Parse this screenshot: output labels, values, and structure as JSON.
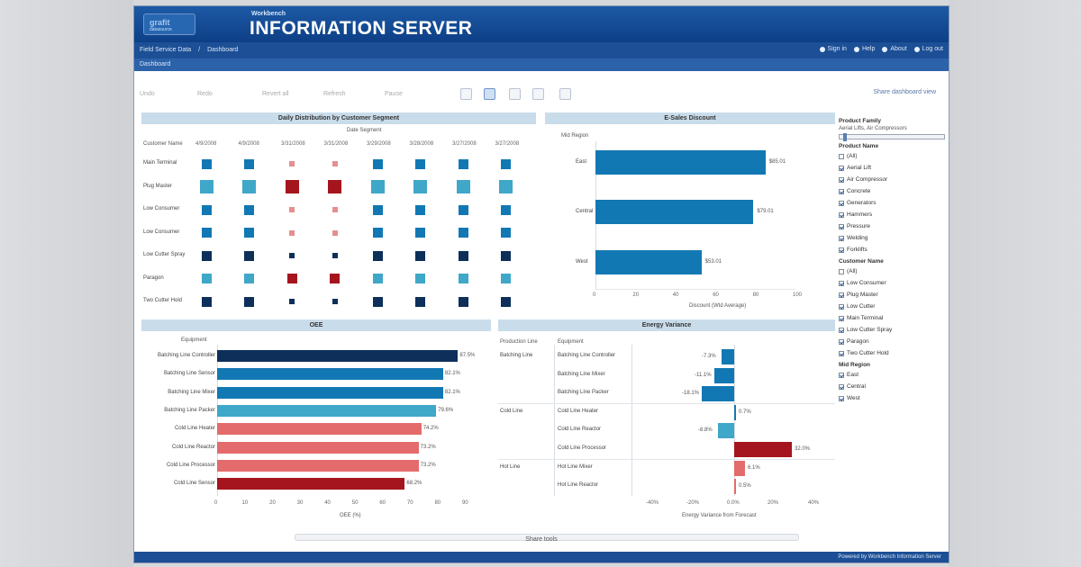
{
  "app": {
    "logo_text": "grafit",
    "logo_sub": "datasource",
    "brand_small": "Workbench",
    "brand_big": "INFORMATION SERVER"
  },
  "nav": {
    "breadcrumbs": [
      "Field Service Data",
      "/",
      "Dashboard"
    ],
    "top_links": [
      "Sign in",
      "Help",
      "About",
      "Log out"
    ],
    "subbar": "Dashboard"
  },
  "toolbar": {
    "labels": [
      "Undo",
      "Redo",
      "Revert all",
      "Refresh",
      "Pause"
    ],
    "share": "Share dashboard view"
  },
  "heatmap": {
    "title": "Daily Distribution by Customer Segment",
    "col_header": "Date Segment",
    "row_header": "Customer Name",
    "columns": [
      "4/9/2008",
      "4/9/2008",
      "3/31/2008",
      "3/31/2008",
      "3/29/2008",
      "3/28/2008",
      "3/27/2008",
      "3/27/2008"
    ],
    "rows": [
      "Main Terminal",
      "Plug Master",
      "Low Consumer",
      "Low Consumer",
      "Low Cutter Spray",
      "Paragon",
      "Two Cutter Hold"
    ],
    "color_codes": [
      [
        "b",
        "b",
        "pl",
        "pl",
        "b",
        "b",
        "b",
        "b"
      ],
      [
        "lb",
        "lb",
        "dr",
        "dr",
        "lb",
        "lb",
        "lb",
        "lb"
      ],
      [
        "b",
        "b",
        "pl",
        "pl",
        "b",
        "b",
        "b",
        "b"
      ],
      [
        "b",
        "b",
        "pl",
        "pl",
        "b",
        "b",
        "b",
        "b"
      ],
      [
        "n",
        "n",
        "n",
        "n",
        "n",
        "n",
        "n",
        "n"
      ],
      [
        "lb",
        "lb",
        "dr",
        "dr",
        "lb",
        "lb",
        "lb",
        "lb"
      ],
      [
        "n",
        "n",
        "n",
        "n",
        "n",
        "n",
        "n",
        "n"
      ]
    ],
    "size_codes": [
      [
        2,
        2,
        1,
        1,
        2,
        2,
        2,
        2
      ],
      [
        3,
        3,
        3,
        3,
        3,
        3,
        3,
        3
      ],
      [
        2,
        2,
        1,
        1,
        2,
        2,
        2,
        2
      ],
      [
        2,
        2,
        1,
        1,
        2,
        2,
        2,
        2
      ],
      [
        2,
        2,
        1,
        1,
        2,
        2,
        2,
        2
      ],
      [
        2,
        2,
        2,
        2,
        2,
        2,
        2,
        2
      ],
      [
        2,
        2,
        1,
        1,
        2,
        2,
        2,
        2
      ]
    ],
    "palette": {
      "b": "#1278b4",
      "lb": "#3fa7c8",
      "n": "#0d2f5a",
      "pl": "#e58f8f",
      "dr": "#a5151d"
    }
  },
  "ecount": {
    "title": "E-Sales Discount",
    "row_header": "Mid Region",
    "categories": [
      "East",
      "Central",
      "West"
    ],
    "values": [
      85.01,
      79.01,
      53.01
    ],
    "value_labels": [
      "$85.01",
      "$79.01",
      "$53.01"
    ],
    "xlim": [
      0,
      100
    ],
    "ticks": [
      "0",
      "20",
      "40",
      "60",
      "80",
      "100"
    ],
    "xlabel": "Discount (Wtd Average)",
    "color": "#1278b4"
  },
  "oee": {
    "title": "OEE",
    "row_header": "Equipment",
    "categories": [
      "Batching Line Controller",
      "Batching Line Sensor",
      "Batching Line Mixer",
      "Batching Line Packer",
      "Cold Line Heater",
      "Cold Line Reactor",
      "Cold Line Processor",
      "Cold Line Sensor"
    ],
    "values": [
      87.5,
      82.1,
      82.1,
      79.6,
      74.2,
      73.2,
      73.2,
      68.2
    ],
    "value_labels": [
      "87.5%",
      "82.1%",
      "82.1%",
      "79.6%",
      "74.2%",
      "73.2%",
      "73.2%",
      "68.2%"
    ],
    "colors": [
      "#0d2f5a",
      "#1278b4",
      "#1278b4",
      "#3fa7c8",
      "#e36b6b",
      "#e36b6b",
      "#e36b6b",
      "#a5151d"
    ],
    "xlim": [
      0,
      90
    ],
    "ticks": [
      "0",
      "10",
      "20",
      "30",
      "40",
      "50",
      "60",
      "70",
      "80",
      "90"
    ],
    "xlabel": "OEE (%)"
  },
  "energy": {
    "title": "Energy Variance",
    "col_headers": [
      "Production Line",
      "Equipment"
    ],
    "groups": [
      {
        "line": "Batching Line",
        "items": [
          "Batching Line Controller",
          "Batching Line Mixer",
          "Batching Line Packer"
        ]
      },
      {
        "line": "Cold Line",
        "items": [
          "Cold Line Heater",
          "Cold Line Reactor",
          "Cold Line Processor"
        ]
      },
      {
        "line": "Hot Line",
        "items": [
          "Hot Line Mixer",
          "Hot Line Reactor"
        ]
      }
    ],
    "values": [
      -0.07,
      -0.11,
      -0.18,
      0.01,
      -0.09,
      0.32,
      0.06,
      0.01
    ],
    "value_labels": [
      "-7.3%",
      "-11.1%",
      "-18.1%",
      "0.7%",
      "-8.8%",
      "32.0%",
      "6.1%",
      "0.5%"
    ],
    "colors": [
      "#1278b4",
      "#1278b4",
      "#1278b4",
      "#1278b4",
      "#3fa7c8",
      "#a5151d",
      "#e36b6b",
      "#e36b6b"
    ],
    "xlim": [
      -0.45,
      0.45
    ],
    "ticks": [
      "-40%",
      "-20%",
      "0.0%",
      "20%",
      "40%"
    ],
    "xlabel": "Energy Variance from Forecast"
  },
  "filters": {
    "slider_title": "Product Family",
    "slider_sub": "Aerial Lifts, Air Compressors",
    "groups": [
      {
        "title": "Product Name",
        "items": [
          {
            "label": "(All)",
            "checked": false
          },
          {
            "label": "Aerial Lift",
            "checked": true
          },
          {
            "label": "Air Compressor",
            "checked": true
          },
          {
            "label": "Concrete",
            "checked": true
          },
          {
            "label": "Generators",
            "checked": true
          },
          {
            "label": "Hammers",
            "checked": true
          },
          {
            "label": "Pressure",
            "checked": true
          },
          {
            "label": "Welding",
            "checked": true
          },
          {
            "label": "Forklifts",
            "checked": true
          }
        ]
      },
      {
        "title": "Customer Name",
        "items": [
          {
            "label": "(All)",
            "checked": false
          },
          {
            "label": "Low Consumer",
            "checked": true
          },
          {
            "label": "Plug Master",
            "checked": true
          },
          {
            "label": "Low Cutter",
            "checked": true
          },
          {
            "label": "Main Terminal",
            "checked": true
          },
          {
            "label": "Low Cutter Spray",
            "checked": true
          },
          {
            "label": "Paragon",
            "checked": true
          },
          {
            "label": "Two Cutter Hold",
            "checked": true
          }
        ]
      },
      {
        "title": "Mid Region",
        "items": [
          {
            "label": "East",
            "checked": true
          },
          {
            "label": "Central",
            "checked": true
          },
          {
            "label": "West",
            "checked": true
          }
        ]
      }
    ]
  },
  "footer": {
    "export": "Share tools",
    "status": "Powered by Workbench Information Server"
  }
}
